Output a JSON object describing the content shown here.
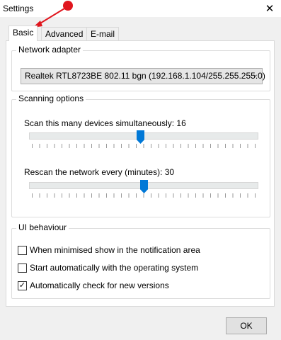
{
  "window": {
    "title": "Settings"
  },
  "tabs": [
    {
      "label": "Basic",
      "active": true
    },
    {
      "label": "Advanced",
      "active": false
    },
    {
      "label": "E-mail",
      "active": false
    }
  ],
  "network_adapter": {
    "legend": "Network adapter",
    "selected": "Realtek RTL8723BE 802.11 bgn (192.168.1.104/255.255.255.0)"
  },
  "scanning": {
    "legend": "Scanning options",
    "devices_label": "Scan this many devices simultaneously: 16",
    "rescan_label": "Rescan the network every (minutes): 30"
  },
  "ui_behaviour": {
    "legend": "UI behaviour",
    "options": [
      {
        "label": "When minimised show in the notification area",
        "checked": false
      },
      {
        "label": "Start automatically with the operating system",
        "checked": false
      },
      {
        "label": "Automatically check for new versions",
        "checked": true
      }
    ]
  },
  "buttons": {
    "ok": "OK"
  },
  "colors": {
    "accent": "#0078d7",
    "annotation": "#e0161e"
  }
}
